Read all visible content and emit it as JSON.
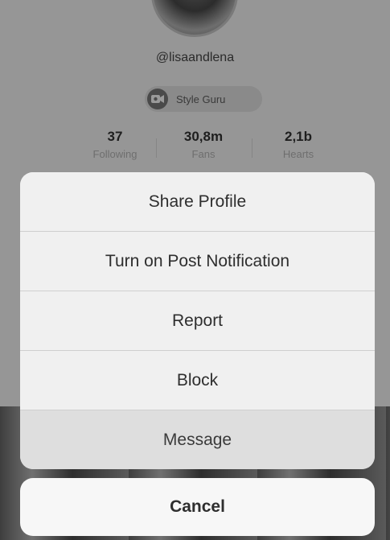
{
  "profile": {
    "username": "@lisaandlena",
    "badge": {
      "icon": "video-camera-icon",
      "label": "Style Guru"
    },
    "stats": [
      {
        "value": "37",
        "label": "Following"
      },
      {
        "value": "30,8m",
        "label": "Fans"
      },
      {
        "value": "2,1b",
        "label": "Hearts"
      }
    ]
  },
  "action_sheet": {
    "items": [
      {
        "label": "Share Profile"
      },
      {
        "label": "Turn on Post Notification"
      },
      {
        "label": "Report"
      },
      {
        "label": "Block"
      },
      {
        "label": "Message"
      }
    ],
    "cancel_label": "Cancel"
  }
}
